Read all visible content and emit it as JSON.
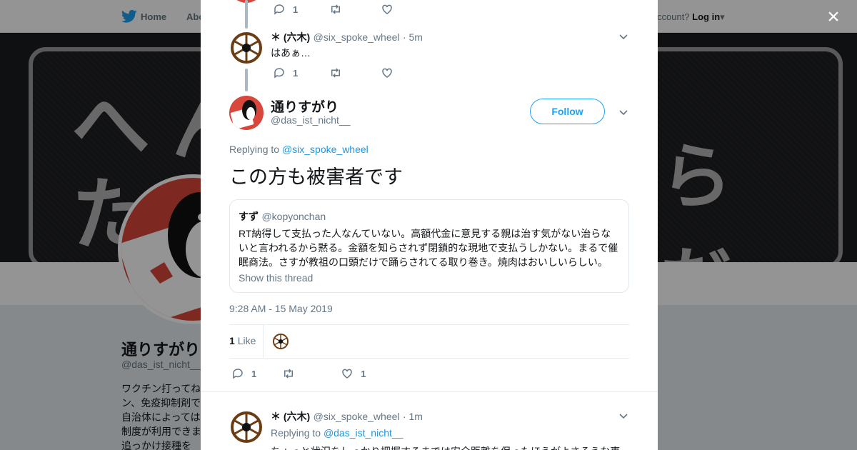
{
  "topbar": {
    "home_label": "Home",
    "about_label": "Abo",
    "account_text": "ccount?",
    "login_label": "Log in"
  },
  "banner": {
    "glyph1": "へん",
    "glyph2": "た",
    "glyph3": "らだ。"
  },
  "profile": {
    "name": "通りすがり",
    "handle": "@das_ist_nicht__",
    "bio_lines": [
      "ワクチン打ってね",
      "ン、免疫抑制剤で",
      "自治体によっては",
      "制度が利用できま",
      "追っかけ接種を"
    ]
  },
  "modal": {
    "close_glyph": "×",
    "top_actions": {
      "reply_count": "1"
    },
    "reply1": {
      "name": "＊ (六木)",
      "handle": "@six_spoke_wheel",
      "time": "· 5m",
      "text": "はあぁ…",
      "reply_count": "1"
    },
    "main": {
      "name": "通りすがり",
      "handle": "@das_ist_nicht__",
      "follow_label": "Follow",
      "replying_prefix": "Replying to",
      "replying_to": "@six_spoke_wheel",
      "text": "この方も被害者です",
      "quote": {
        "name": "すず",
        "handle": "@kopyonchan",
        "text": "RT納得して支払った人なんていない。高額代金に意見する親は治す気がない治らないと言われるから黙る。金額を知らされず閉鎖的な現地で支払うしかない。まるで催眠商法。さすが教祖の口頭だけで踊らされてる取り巻き。焼肉はおいしいらしい。",
        "show_thread": "Show this thread"
      },
      "timestamp": "9:28 AM - 15 May 2019",
      "like_count": "1",
      "like_label": "Like",
      "reply_count": "1",
      "fav_count": "1"
    },
    "reply2": {
      "name": "＊ (六木)",
      "handle": "@six_spoke_wheel",
      "time": "· 1m",
      "replying_prefix": "Replying to",
      "replying_to": "@das_ist_nicht__",
      "text": "ちょっと状況をしっかり把握するまでは安全距離を保ったほうがよさそうな事"
    }
  },
  "colors": {
    "accent": "#1da1f2",
    "link": "#1b95e0",
    "muted": "#657786",
    "thread": "#aab8c2"
  }
}
